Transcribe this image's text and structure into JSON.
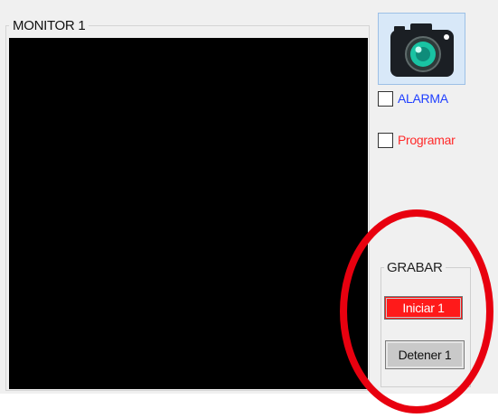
{
  "monitor": {
    "title": "MONITOR 1"
  },
  "side": {
    "camera_icon": "camera-icon",
    "alarm_label": "ALARMA",
    "alarm_checked": false,
    "alarm_color": "#1f3fff",
    "program_label": "Programar",
    "program_checked": false,
    "program_color": "#ff2a2a"
  },
  "record": {
    "group_title": "GRABAR",
    "start_label": "Iniciar 1",
    "stop_label": "Detener 1",
    "start_color": "#ff1a1a"
  },
  "annotation": {
    "ellipse_color": "#e8000f"
  }
}
